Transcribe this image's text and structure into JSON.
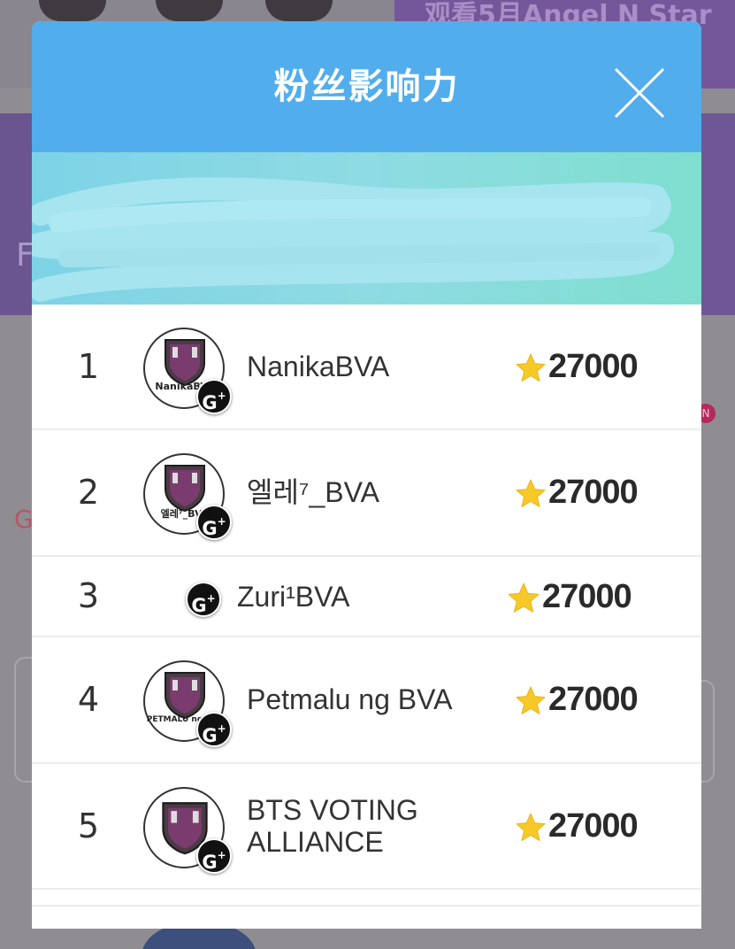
{
  "background": {
    "banner_text": "观看5月Angel N Star",
    "left_letter": "F",
    "left_pink_letter": "G",
    "badge_text": "N"
  },
  "modal": {
    "title": "粉丝影响力",
    "close_icon": "close-icon",
    "header_color": "#52adec"
  },
  "ranking": [
    {
      "rank": "1",
      "name": "NanikaBVA",
      "avatar_caption": "NanikaBVA",
      "has_avatar": true,
      "score": "27000"
    },
    {
      "rank": "2",
      "name": "엘레⁷_BVA",
      "avatar_caption": "엘레⁷_BVA",
      "has_avatar": true,
      "score": "27000"
    },
    {
      "rank": "3",
      "name": "Zuri¹BVA",
      "avatar_caption": "",
      "has_avatar": false,
      "score": "27000"
    },
    {
      "rank": "4",
      "name": "Petmalu ng BVA",
      "avatar_caption": "PETMALU ng BVA",
      "has_avatar": true,
      "score": "27000"
    },
    {
      "rank": "5",
      "name": "BTS VOTING ALLIANCE",
      "avatar_caption": "",
      "has_avatar": true,
      "score": "27000"
    }
  ],
  "icons": {
    "score": "star-icon",
    "badge": "gplus-icon",
    "avatar_logo": "shield-logo-icon"
  },
  "colors": {
    "star": "#f7c928",
    "gplus": "#111111"
  }
}
